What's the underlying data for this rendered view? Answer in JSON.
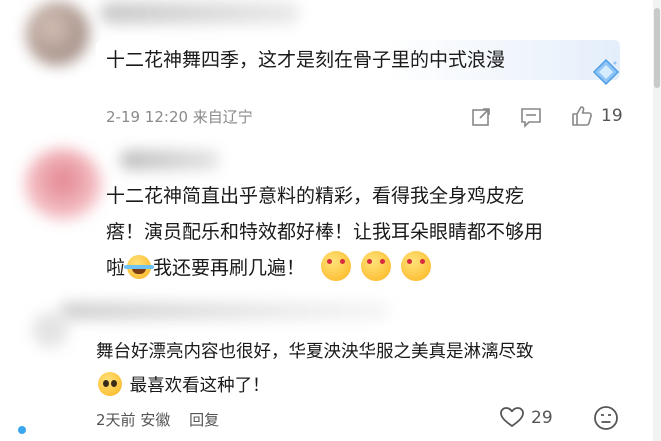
{
  "comments": [
    {
      "text": "十二花神舞四季，这才是刻在骨子里的中式浪漫",
      "meta": "2-19 12:20 来自辽宁",
      "like_count": "19",
      "icons": [
        "share-icon",
        "comment-icon",
        "thumbs-up-icon",
        "diamond-badge-icon"
      ]
    },
    {
      "text_line1": "十二花神简直出乎意料的精彩，看得我全身鸡皮疙",
      "text_line2": "瘩！演员配乐和特效都好棒！让我耳朵眼睛都不够用",
      "text_line3_a": "啦",
      "text_line3_b": "我还要再刷几遍！",
      "emojis": [
        "laugh-cry-emoji",
        "heart-eyes-emoji",
        "heart-eyes-emoji",
        "heart-eyes-emoji"
      ]
    },
    {
      "text_line1": "舞台好漂亮内容也很好，华夏泱泱华服之美真是淋漓尽致",
      "text_line2": "最喜欢看这种了！",
      "meta_time": "2天前",
      "meta_location": "安徽",
      "reply_label": "回复",
      "like_count": "29",
      "icons": [
        "heart-icon",
        "emoji-reaction-icon",
        "pleading-emoji"
      ]
    }
  ],
  "colors": {
    "accent_blue": "#39a6f0",
    "meta_gray": "#8a8a8a"
  }
}
